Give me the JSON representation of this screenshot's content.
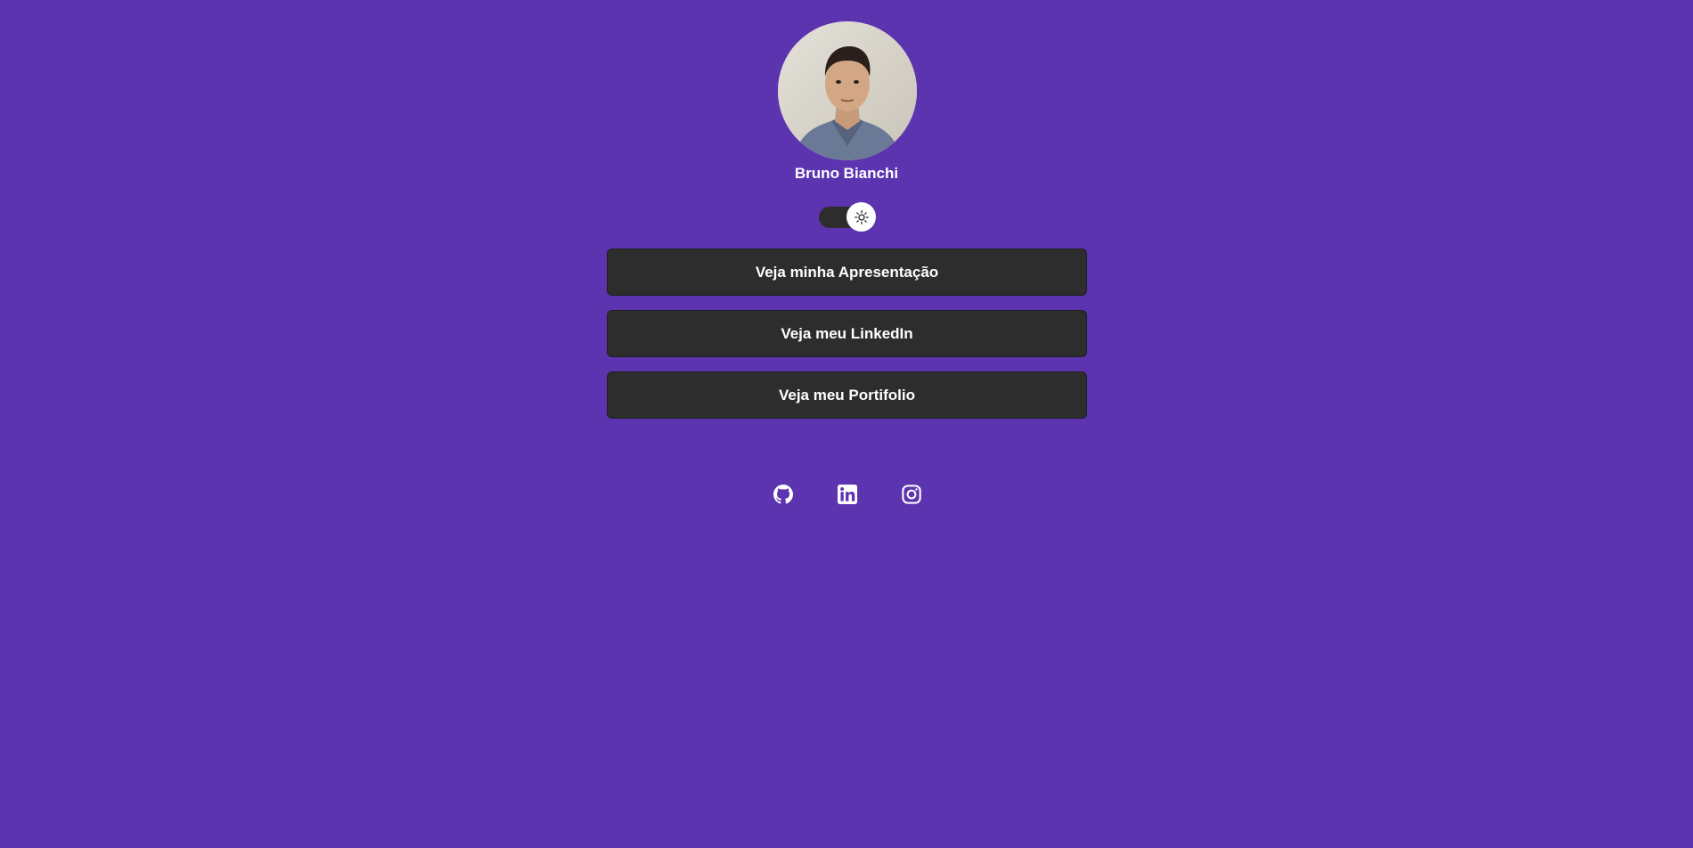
{
  "profile": {
    "name": "Bruno Bianchi"
  },
  "theme_toggle": {
    "icon": "sun-icon"
  },
  "links": [
    {
      "label": "Veja minha Apresentação"
    },
    {
      "label": "Veja meu LinkedIn"
    },
    {
      "label": "Veja meu Portifolio"
    }
  ],
  "socials": [
    {
      "icon": "github-icon"
    },
    {
      "icon": "linkedin-icon"
    },
    {
      "icon": "instagram-icon"
    }
  ],
  "colors": {
    "background": "#5c34b0",
    "button": "#2d2d2d",
    "text": "#ffffff"
  }
}
